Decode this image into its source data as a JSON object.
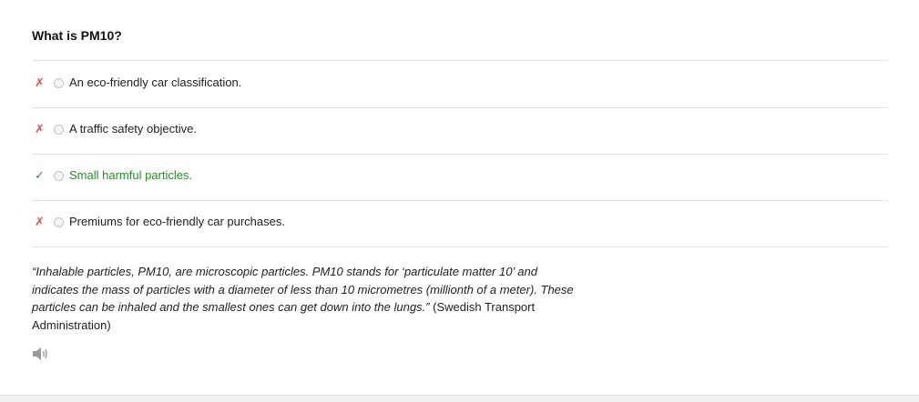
{
  "question": {
    "title": "What is PM10?"
  },
  "answers": [
    {
      "mark": "✗",
      "status": "wrong",
      "label": "An eco-friendly car classification."
    },
    {
      "mark": "✗",
      "status": "wrong",
      "label": "A traffic safety objective."
    },
    {
      "mark": "✓",
      "status": "correct",
      "label": "Small harmful particles."
    },
    {
      "mark": "✗",
      "status": "wrong",
      "label": "Premiums for eco-friendly car purchases."
    }
  ],
  "explanation": {
    "quote": "“Inhalable particles, PM10, are microscopic particles. PM10 stands for ‘particulate matter 10’ and indicates the mass of particles with a diameter of less than 10 micrometres (millionth of a meter). These particles can be inhaled and the smallest ones can get down into the lungs.”",
    "source": " (Swedish Transport Administration)"
  },
  "audio": {
    "icon": "speaker-icon"
  },
  "colors": {
    "wrong_mark": "#d9534f",
    "correct_mark": "#3c8b3c",
    "correct_text": "#2a8a2a",
    "divider": "#e3e3e3"
  }
}
